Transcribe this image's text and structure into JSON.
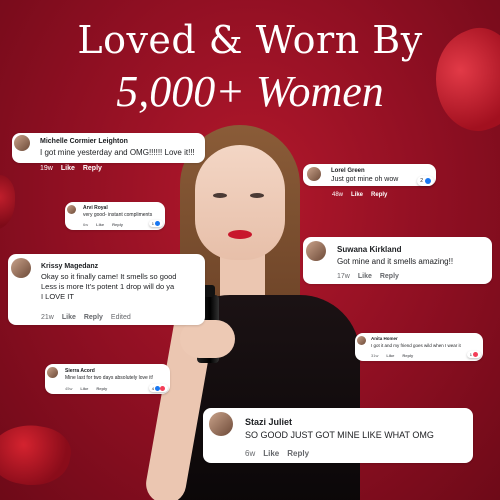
{
  "headline": {
    "line1": "Loved & Worn By",
    "line2": "5,000+ Women"
  },
  "comments": [
    {
      "name": "Michelle Cormier Leighton",
      "text": "I got mine yesterday and OMG!!!!!! Love it!!!",
      "time": "19w",
      "like": "Like",
      "reply": "Reply"
    },
    {
      "name": "Lorel Green",
      "text": "Just got mine oh wow",
      "time": "48w",
      "like": "Like",
      "reply": "Reply",
      "reaction_count": "2"
    },
    {
      "name": "Arvi Royal",
      "text": "very good- instant compliments",
      "time": "6w",
      "like": "Like",
      "reply": "Reply",
      "reaction_count": "1"
    },
    {
      "name": "Suwana Kirkland",
      "text": "Got mine and it smells amazing!!",
      "time": "17w",
      "like": "Like",
      "reply": "Reply"
    },
    {
      "name": "Krissy Magedanz",
      "text": "Okay so it finally came! It smells so good\nLess is more It's potent 1 drop will do ya\nI LOVE IT",
      "time": "21w",
      "like": "Like",
      "reply": "Reply",
      "edited": "Edited"
    },
    {
      "name": "Anita Homer",
      "text": "I got it and my friend goes wild when I wear it",
      "time": "31w",
      "like": "Like",
      "reply": "Reply",
      "reaction_count": "1"
    },
    {
      "name": "Sierra Acord",
      "text": "Mine last for two days absolutely love it!",
      "time": "45w",
      "like": "Like",
      "reply": "Reply",
      "reaction_count": "4"
    },
    {
      "name": "Stazi Juliet",
      "text": "SO GOOD JUST GOT MINE LIKE WHAT OMG",
      "time": "6w",
      "like": "Like",
      "reply": "Reply"
    }
  ],
  "colors": {
    "background": "#9c1226",
    "card": "#ffffff",
    "like_blue": "#1877f2",
    "love_red": "#f33e58"
  }
}
